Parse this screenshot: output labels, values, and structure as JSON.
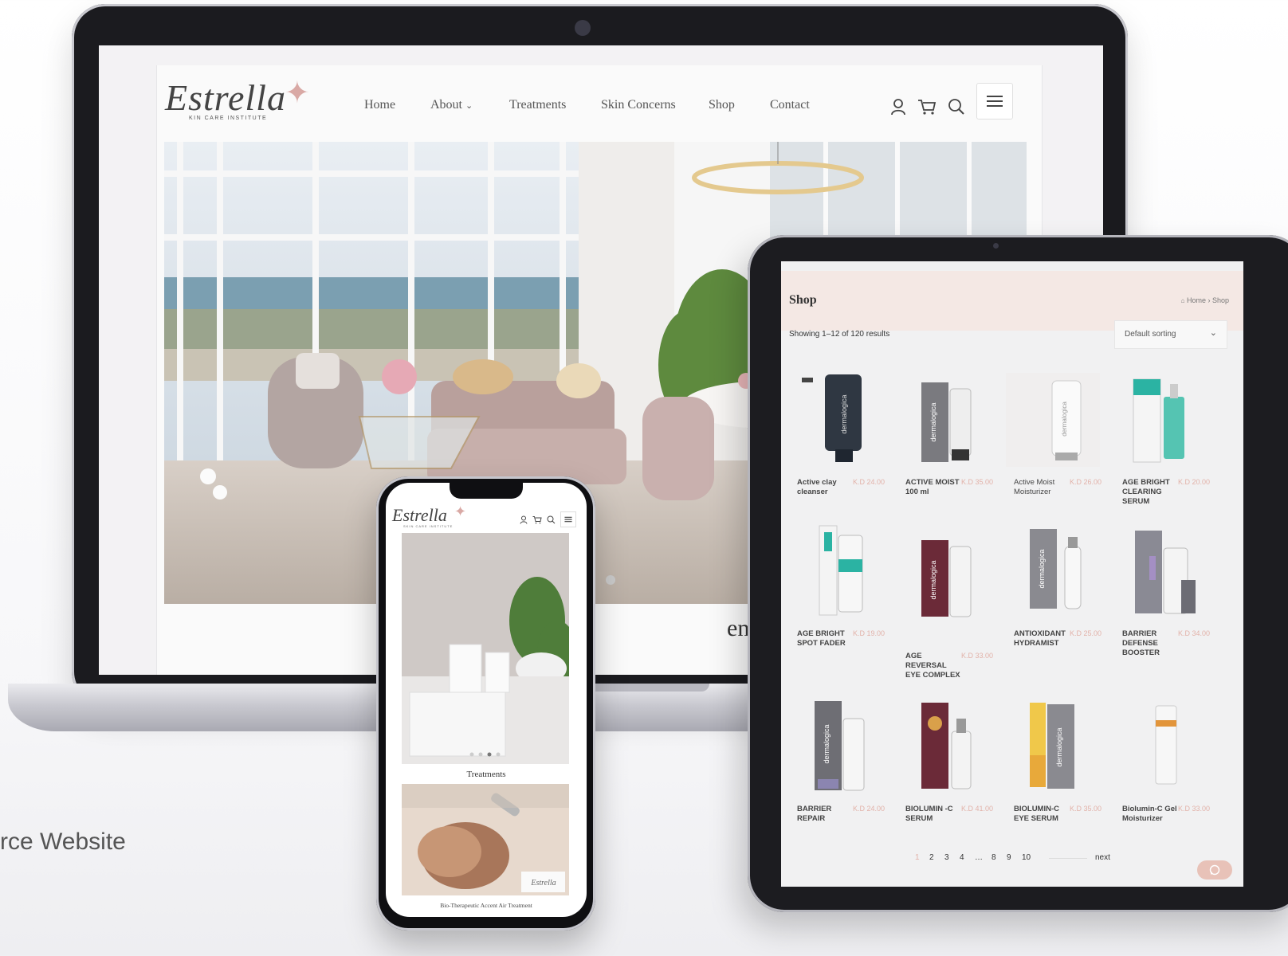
{
  "caption": "rce Website",
  "laptop": {
    "logo_text": "Estrella",
    "logo_sub": "KIN CARE INSTITUTE",
    "nav": [
      "Home",
      "About",
      "Treatments",
      "Skin Concerns",
      "Shop",
      "Contact"
    ],
    "section_title": "ents",
    "icons": [
      "user-icon",
      "cart-icon",
      "search-icon",
      "menu-icon"
    ]
  },
  "phone": {
    "logo_text": "Estrella",
    "logo_sub": "SKIN CARE INSTITUTE",
    "section_title": "Treatments",
    "image_caption": "Bio-Therapeutic Accent Air Treatment",
    "slider_dots": 4,
    "slider_active": 3
  },
  "tablet": {
    "title": "Shop",
    "breadcrumb": "Home › Shop",
    "results": "Showing 1–12 of 120 results",
    "sorting": "Default sorting",
    "products": [
      {
        "name": "Active clay cleanser",
        "price": "K.D 24.00"
      },
      {
        "name": "ACTIVE MOIST 100 ml",
        "price": "K.D 35.00"
      },
      {
        "name": "Active Moist Moisturizer",
        "price": "K.D 26.00"
      },
      {
        "name": "AGE BRIGHT CLEARING SERUM",
        "price": "K.D 20.00"
      },
      {
        "name": "AGE BRIGHT SPOT FADER",
        "price": "K.D 19.00"
      },
      {
        "name": "AGE REVERSAL EYE COMPLEX",
        "price": "K.D 33.00"
      },
      {
        "name": "ANTIOXIDANT HYDRAMIST",
        "price": "K.D 25.00"
      },
      {
        "name": "BARRIER DEFENSE BOOSTER",
        "price": "K.D 34.00"
      },
      {
        "name": "BARRIER REPAIR",
        "price": "K.D 24.00"
      },
      {
        "name": "BIOLUMIN -C SERUM",
        "price": "K.D 41.00"
      },
      {
        "name": "BIOLUMIN-C EYE SERUM",
        "price": "K.D 35.00"
      },
      {
        "name": "Biolumin-C Gel Moisturizer",
        "price": "K.D 33.00"
      }
    ],
    "pagination": [
      "1",
      "2",
      "3",
      "4",
      "…",
      "8",
      "9",
      "10"
    ],
    "next_label": "next",
    "brand_label": "dermalogica",
    "colors": {
      "price": "#e2b2a9",
      "band": "#f4e8e4",
      "accent": "#d9a9a5"
    }
  }
}
